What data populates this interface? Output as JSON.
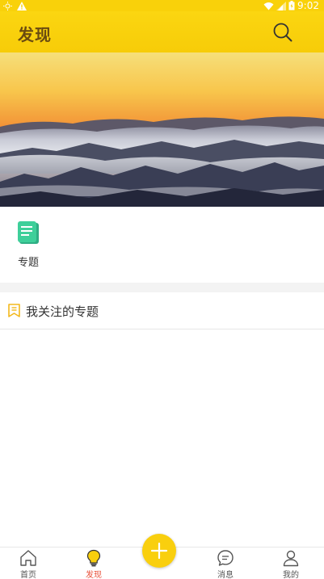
{
  "status_bar": {
    "time": "9:02",
    "icons": [
      "brightness-icon",
      "warning-icon",
      "wifi-icon",
      "signal-icon",
      "battery-icon"
    ]
  },
  "header": {
    "title": "发现",
    "search_icon": "search-icon"
  },
  "banner": {
    "description_icon": "sunset-mountains-image"
  },
  "entries": [
    {
      "label": "专题",
      "icon": "topic-document-icon",
      "icon_color": "#3ecf9a"
    }
  ],
  "follow_section": {
    "title": "我关注的专题",
    "icon": "bookmark-icon",
    "icon_color": "#f3b81c"
  },
  "tab_bar": {
    "tabs": [
      {
        "label": "首页",
        "icon": "home-icon"
      },
      {
        "label": "发现",
        "icon": "lightbulb-icon",
        "active": true
      },
      {
        "label": "消息",
        "icon": "message-icon"
      },
      {
        "label": "我的",
        "icon": "profile-icon"
      }
    ],
    "fab_icon": "plus-icon"
  },
  "colors": {
    "primary": "#f9d10a",
    "title_text": "#6a4b10",
    "active_tab": "#e8503a"
  }
}
